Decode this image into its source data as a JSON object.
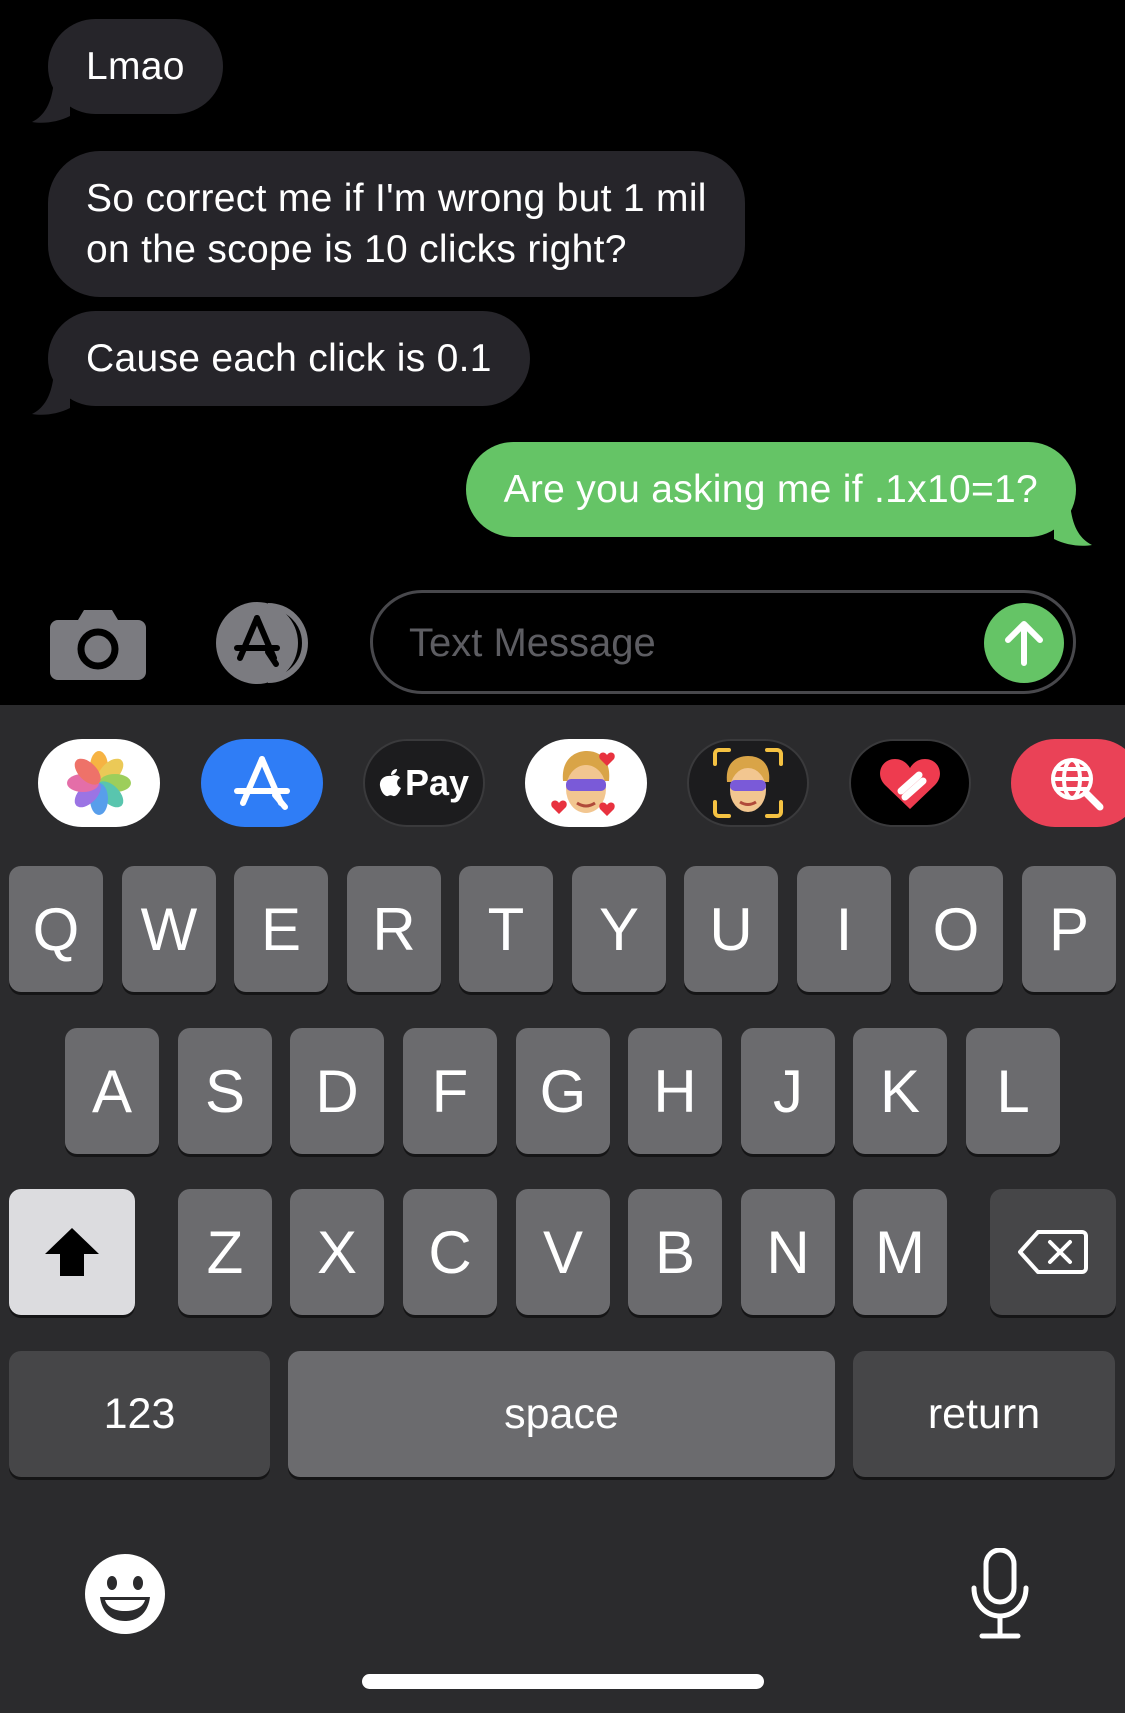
{
  "messages": [
    {
      "direction": "incoming",
      "text": "Lmao"
    },
    {
      "direction": "incoming",
      "text": "So correct me if I'm wrong but 1 mil\non the scope is 10 clicks right?"
    },
    {
      "direction": "incoming",
      "text": "Cause each click is 0.1"
    },
    {
      "direction": "outgoing",
      "text": "Are you asking me if .1x10=1?"
    }
  ],
  "input": {
    "placeholder": "Text Message",
    "value": ""
  },
  "apps_row": [
    {
      "name": "photos",
      "icon": "photos-icon"
    },
    {
      "name": "app-store",
      "icon": "app-store-icon"
    },
    {
      "name": "apple-pay",
      "icon": "apple-pay-icon",
      "label": "Pay"
    },
    {
      "name": "memoji-stickers",
      "icon": "memoji-sticker-icon"
    },
    {
      "name": "memoji",
      "icon": "memoji-icon"
    },
    {
      "name": "digital-touch",
      "icon": "heart-icon"
    },
    {
      "name": "images-search",
      "icon": "globe-search-icon"
    }
  ],
  "keyboard": {
    "row1": [
      "Q",
      "W",
      "E",
      "R",
      "T",
      "Y",
      "U",
      "I",
      "O",
      "P"
    ],
    "row2": [
      "A",
      "S",
      "D",
      "F",
      "G",
      "H",
      "J",
      "K",
      "L"
    ],
    "row3": [
      "Z",
      "X",
      "C",
      "V",
      "B",
      "N",
      "M"
    ],
    "numbers_label": "123",
    "space_label": "space",
    "return_label": "return"
  },
  "colors": {
    "background": "#000000",
    "incoming_bubble": "#26252a",
    "outgoing_bubble": "#65c466",
    "keyboard_bg": "#2b2b2d",
    "key": "#6b6b6e",
    "function_key": "#464648"
  }
}
